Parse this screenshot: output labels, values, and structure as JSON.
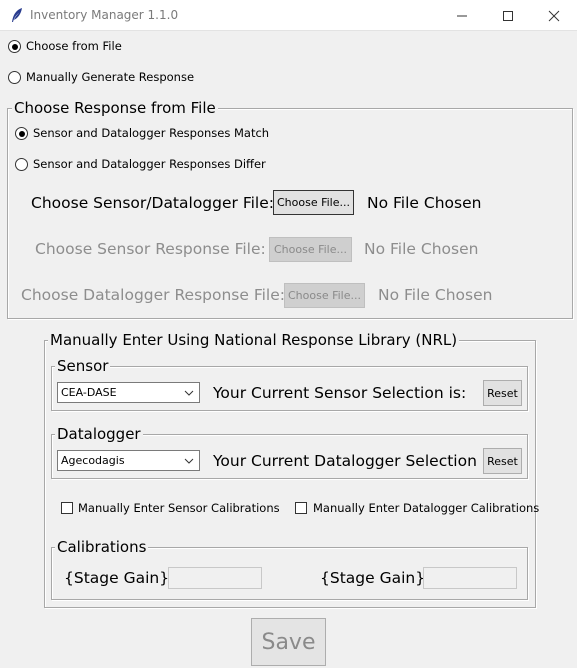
{
  "window": {
    "title": "Inventory Manager 1.1.0"
  },
  "mode": {
    "choose_from_file": "Choose from File",
    "manual_generate": "Manually Generate Response",
    "selected": "choose_from_file"
  },
  "file_section": {
    "legend": "Choose Response from File",
    "match_label": "Sensor and Datalogger Responses Match",
    "differ_label": "Sensor and Datalogger Responses Differ",
    "selected": "match",
    "rows": [
      {
        "label": "Choose Sensor/Datalogger File:",
        "button": "Choose File...",
        "status": "No File Chosen",
        "enabled": true
      },
      {
        "label": "Choose Sensor Response File:",
        "button": "Choose File...",
        "status": "No File Chosen",
        "enabled": false
      },
      {
        "label": "Choose Datalogger Response File:",
        "button": "Choose File...",
        "status": "No File Chosen",
        "enabled": false
      }
    ]
  },
  "nrl_section": {
    "legend": "Manually Enter Using National Response Library (NRL)",
    "sensor": {
      "legend": "Sensor",
      "selected_value": "CEA-DASE",
      "selection_label": "Your Current Sensor Selection is:",
      "reset": "Reset"
    },
    "datalogger": {
      "legend": "Datalogger",
      "selected_value": "Agecodagis",
      "selection_label": "Your Current Datalogger Selection is:",
      "reset": "Reset"
    },
    "manual_sensor_cal": "Manually Enter Sensor Calibrations",
    "manual_datalogger_cal": "Manually Enter Datalogger Calibrations",
    "calibrations": {
      "legend": "Calibrations",
      "left_label": "{Stage Gain}",
      "right_label": "{Stage Gain}",
      "left_value": "",
      "right_value": ""
    }
  },
  "save_label": "Save",
  "icons": {
    "app": "feather-icon",
    "minimize": "minimize-icon",
    "maximize": "maximize-icon",
    "close": "close-icon",
    "dropdown": "chevron-down-icon"
  }
}
